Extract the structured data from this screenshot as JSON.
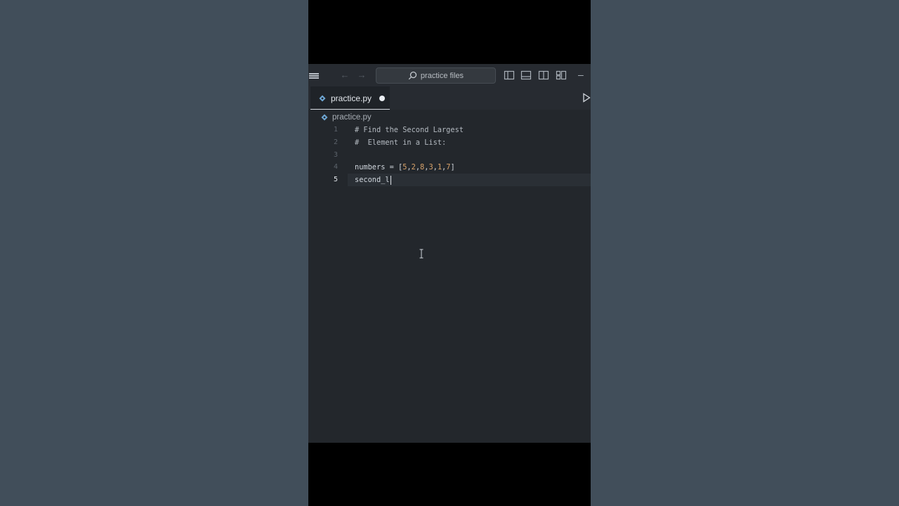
{
  "titlebar": {
    "search_label": "practice files",
    "icons": [
      "menu-icon",
      "back-arrow-icon",
      "forward-arrow-icon",
      "search-icon",
      "toggle-primary-sidebar-icon",
      "toggle-panel-icon",
      "toggle-secondary-sidebar-icon",
      "customize-layout-icon",
      "minimize-icon"
    ]
  },
  "tab": {
    "label": "practice.py",
    "modified": true,
    "icon": "python-file-icon"
  },
  "editor": {
    "breadcrumb": "practice.py",
    "active_line": 5,
    "lines": [
      {
        "number": "1",
        "tokens": [
          {
            "text": "# Find the Second Largest",
            "kind": "comment"
          }
        ]
      },
      {
        "number": "2",
        "tokens": [
          {
            "text": "#  Element in a List:",
            "kind": "comment"
          }
        ]
      },
      {
        "number": "3",
        "tokens": []
      },
      {
        "number": "4",
        "tokens": [
          {
            "text": "numbers",
            "kind": "ident"
          },
          {
            "text": " = ",
            "kind": "op"
          },
          {
            "text": "[",
            "kind": "op"
          },
          {
            "text": "5",
            "kind": "num"
          },
          {
            "text": ",",
            "kind": "op"
          },
          {
            "text": "2",
            "kind": "num"
          },
          {
            "text": ",",
            "kind": "op"
          },
          {
            "text": "8",
            "kind": "num"
          },
          {
            "text": ",",
            "kind": "op"
          },
          {
            "text": "3",
            "kind": "num"
          },
          {
            "text": ",",
            "kind": "op"
          },
          {
            "text": "1",
            "kind": "num"
          },
          {
            "text": ",",
            "kind": "op"
          },
          {
            "text": "7",
            "kind": "num"
          },
          {
            "text": "]",
            "kind": "op"
          }
        ]
      },
      {
        "number": "5",
        "tokens": [
          {
            "text": "second_l",
            "kind": "ident"
          }
        ]
      }
    ]
  },
  "colors": {
    "background": "#414e5a",
    "editor_bg": "#23272c",
    "titlebar_bg": "#272b31",
    "comment": "#b2b8bf",
    "number": "#d9a36a",
    "identifier": "#cfd5dc"
  }
}
